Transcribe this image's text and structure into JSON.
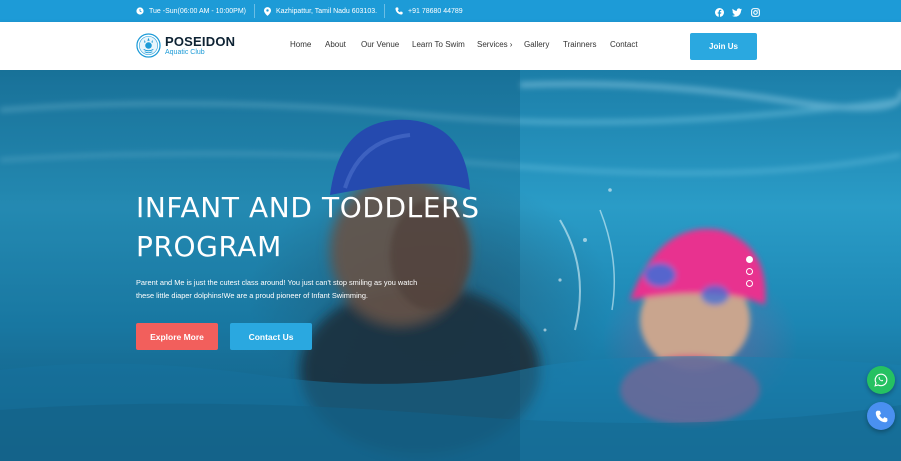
{
  "topbar": {
    "hours": "Tue -Sun(06:00 AM - 10:00PM)",
    "address": "Kazhipattur, Tamil Nadu 603103.",
    "phone": "+91 78680 44789",
    "social_icons": [
      "facebook-icon",
      "twitter-icon",
      "instagram-icon"
    ]
  },
  "brand": {
    "name": "POSEIDON",
    "tagline": "Aquatic Club"
  },
  "nav": {
    "items": [
      "Home",
      "About",
      "Our Venue",
      "Learn To Swim",
      "Services",
      "Gallery",
      "Trainners",
      "Contact"
    ],
    "join_label": "Join Us"
  },
  "hero": {
    "title_line1": "INFANT AND TODDLERS",
    "title_line2": "PROGRAM",
    "desc_line1": "Parent and Me is just the cutest class around! You just can't stop smiling as you watch",
    "desc_line2": "these little diaper dolphins!We are a proud pioneer of Infant Swimming.",
    "explore_label": "Explore More",
    "contact_label": "Contact Us",
    "slide_count": 3,
    "active_slide": 1
  },
  "floating": {
    "whatsapp_icon": "whatsapp-icon",
    "call_icon": "phone-icon"
  },
  "colors": {
    "primary": "#1d9bd7",
    "button_blue": "#2aa8e0",
    "button_coral": "#f25f5c",
    "whatsapp": "#25c162",
    "call": "#4a90f0"
  }
}
